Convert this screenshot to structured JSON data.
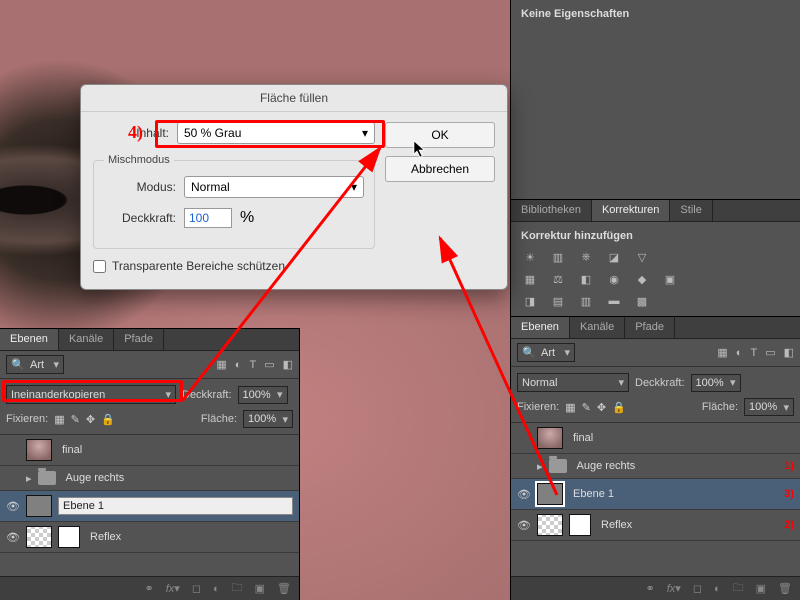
{
  "dialog": {
    "title": "Fläche füllen",
    "content_label": "Inhalt:",
    "content_value": "50 % Grau",
    "group_label": "Mischmodus",
    "mode_label": "Modus:",
    "mode_value": "Normal",
    "opacity_label": "Deckkraft:",
    "opacity_value": "100",
    "opacity_unit": "%",
    "cb_label": "Transparente Bereiche schützen",
    "ok": "OK",
    "cancel": "Abbrechen"
  },
  "right": {
    "props_title": "Keine Eigenschaften",
    "lib_tabs": [
      "Bibliotheken",
      "Korrekturen",
      "Stile"
    ],
    "korr_sub": "Korrektur hinzufügen"
  },
  "layers": {
    "tabs": [
      "Ebenen",
      "Kanäle",
      "Pfade"
    ],
    "filter_label": "Art",
    "blend_left": "Ineinanderkopieren",
    "blend_right": "Normal",
    "opacity_label": "Deckkraft:",
    "opacity_value": "100%",
    "lock_label": "Fixieren:",
    "fill_label": "Fläche:",
    "fill_value": "100%",
    "items": [
      {
        "name": "final"
      },
      {
        "name": "Auge rechts"
      },
      {
        "name": "Ebene 1"
      },
      {
        "name": "Reflex"
      }
    ]
  },
  "anno": {
    "a4": "4)",
    "a1": "1)",
    "a2": "2)",
    "a3": "3)"
  }
}
